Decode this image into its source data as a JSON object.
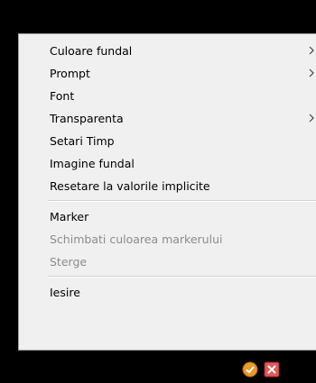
{
  "menu": {
    "items": [
      {
        "label": "Culoare fundal",
        "submenu": true,
        "disabled": false
      },
      {
        "label": "Prompt",
        "submenu": true,
        "disabled": false
      },
      {
        "label": "Font",
        "submenu": false,
        "disabled": false
      },
      {
        "label": "Transparenta",
        "submenu": true,
        "disabled": false
      },
      {
        "label": "Setari Timp",
        "submenu": false,
        "disabled": false
      },
      {
        "label": "Imagine fundal",
        "submenu": false,
        "disabled": false
      },
      {
        "label": "Resetare la valorile implicite",
        "submenu": false,
        "disabled": false
      },
      {
        "label": "Marker",
        "submenu": false,
        "disabled": false
      },
      {
        "label": "Schimbati culoarea markerului",
        "submenu": false,
        "disabled": true
      },
      {
        "label": "Sterge",
        "submenu": false,
        "disabled": true
      },
      {
        "label": "Iesire",
        "submenu": false,
        "disabled": false
      }
    ]
  },
  "tray": {
    "icons": [
      "checkmark-shield-icon",
      "close-red-icon"
    ]
  },
  "colors": {
    "menu_background": "#f0f0f0",
    "disabled_text": "#8c8c8c",
    "tray_close": "#e25a5a",
    "tray_check": "#e89a2c"
  }
}
